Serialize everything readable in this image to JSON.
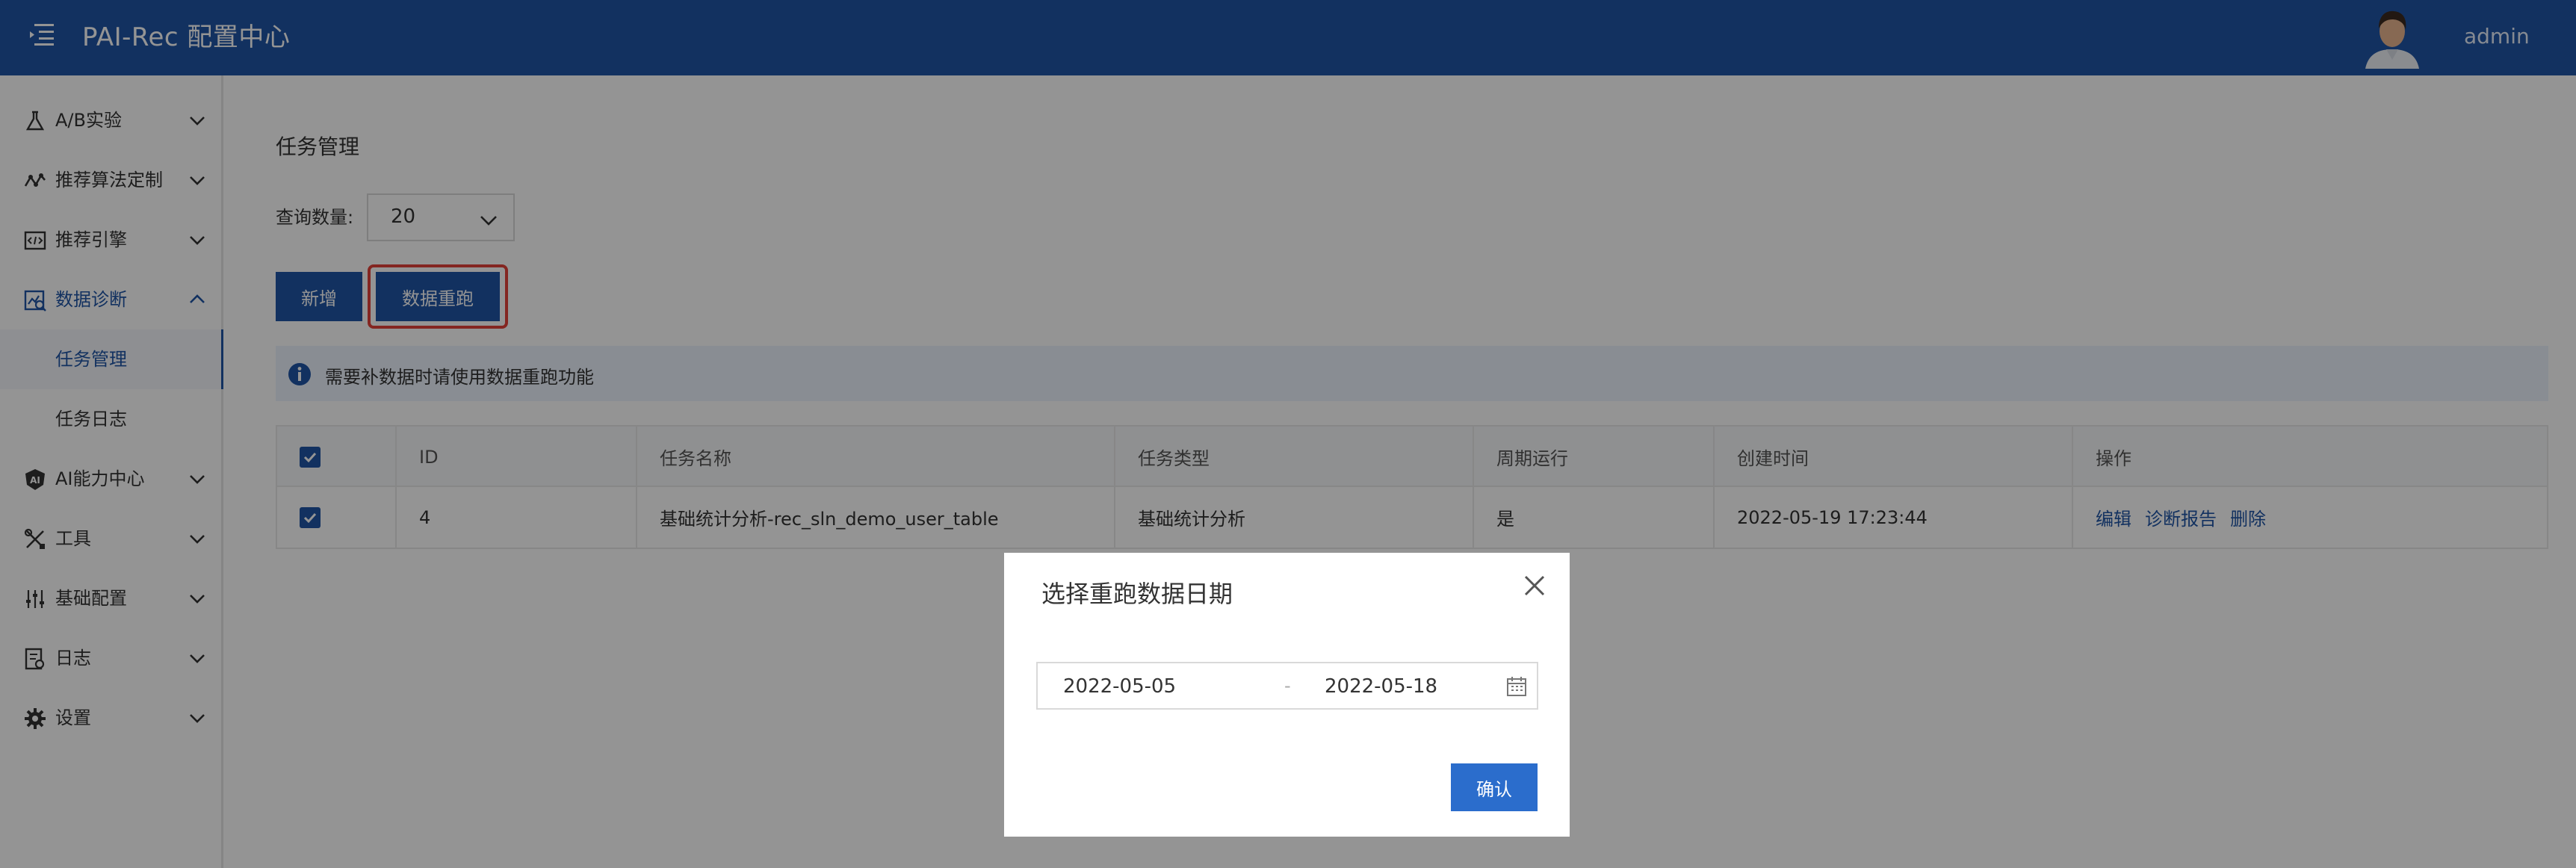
{
  "header": {
    "app_title": "PAI-Rec 配置中心",
    "user_name": "admin"
  },
  "sidebar": {
    "items": [
      {
        "label": "A/B实验",
        "icon": "flask-icon"
      },
      {
        "label": "推荐算法定制",
        "icon": "network-icon"
      },
      {
        "label": "推荐引擎",
        "icon": "code-icon"
      },
      {
        "label": "数据诊断",
        "icon": "chart-search-icon"
      },
      {
        "label": "AI能力中心",
        "icon": "ai-icon"
      },
      {
        "label": "工具",
        "icon": "tools-icon"
      },
      {
        "label": "基础配置",
        "icon": "sliders-icon"
      },
      {
        "label": "日志",
        "icon": "log-icon"
      },
      {
        "label": "设置",
        "icon": "gear-icon"
      }
    ],
    "sub_items": [
      {
        "label": "任务管理"
      },
      {
        "label": "任务日志"
      }
    ]
  },
  "main": {
    "page_title": "任务管理",
    "query_label": "查询数量:",
    "query_value": "20",
    "add_button": "新增",
    "rerun_button": "数据重跑",
    "info_text": "需要补数据时请使用数据重跑功能",
    "table": {
      "headers": [
        "ID",
        "任务名称",
        "任务类型",
        "周期运行",
        "创建时间",
        "操作"
      ],
      "rows": [
        {
          "id": "4",
          "name": "基础统计分析-rec_sln_demo_user_table",
          "type": "基础统计分析",
          "periodic": "是",
          "created": "2022-05-19 17:23:44",
          "actions": [
            "编辑",
            "诊断报告",
            "删除"
          ]
        }
      ]
    }
  },
  "modal": {
    "title": "选择重跑数据日期",
    "start_date": "2022-05-05",
    "separator": "-",
    "end_date": "2022-05-18",
    "confirm_button": "确认"
  },
  "colors": {
    "primary": "#1f55a6",
    "highlight": "#e4433a"
  }
}
